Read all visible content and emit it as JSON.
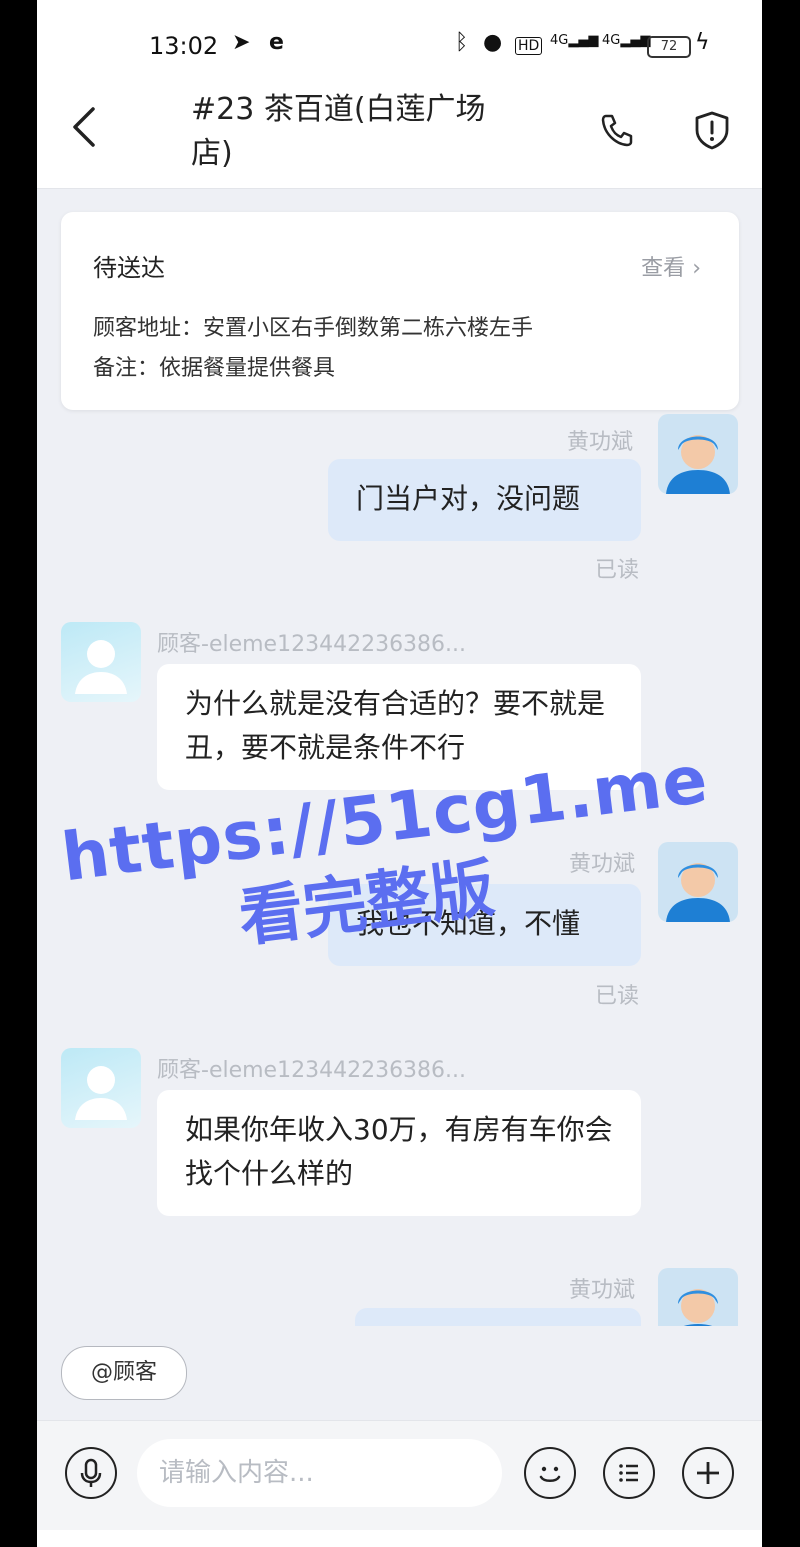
{
  "status_bar": {
    "time": "13:02",
    "battery": "72",
    "network_1": "4G",
    "network_2": "4G",
    "hd": "HD"
  },
  "header": {
    "title": "#23 茶百道(白莲广场店)"
  },
  "order_card": {
    "status": "待送达",
    "view_label": "查看",
    "address": "顾客地址：安置小区右手倒数第二栋六楼左手",
    "note": "备注：依据餐量提供餐具"
  },
  "messages": [
    {
      "sender": "rider",
      "name": "黄功斌",
      "text": "门当户对，没问题",
      "read": "已读"
    },
    {
      "sender": "customer",
      "name": "顾客-eleme123442236386...",
      "text": "为什么就是没有合适的？要不就是丑，要不就是条件不行"
    },
    {
      "sender": "rider",
      "name": "黄功斌",
      "text": "我也不知道，不懂",
      "read": "已读"
    },
    {
      "sender": "customer",
      "name": "顾客-eleme123442236386...",
      "text": "如果你年收入30万，有房有车你会找个什么样的"
    },
    {
      "sender": "rider",
      "name": "黄功斌",
      "text": ""
    }
  ],
  "mention_button": "@顾客",
  "input": {
    "placeholder": "请输入内容..."
  },
  "watermark": {
    "line1": "https://51cg1.me",
    "line2": "看完整版"
  },
  "colors": {
    "my_bubble": "#dde9f9",
    "their_bubble": "#ffffff",
    "background": "#eef0f5",
    "watermark": "#5b6ef0"
  }
}
